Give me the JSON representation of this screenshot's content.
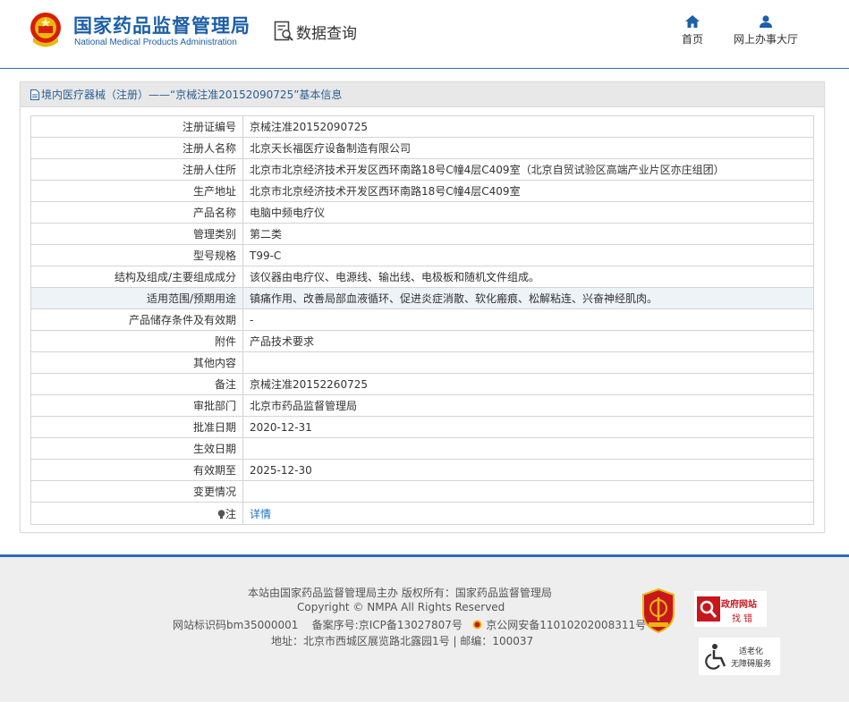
{
  "header": {
    "logo_cn": "国家药品监督管理局",
    "logo_en": "National Medical Products Administration",
    "data_query": "数据查询",
    "nav": [
      {
        "label": "首页",
        "icon": "home-icon"
      },
      {
        "label": "网上办事大厅",
        "icon": "user-icon"
      }
    ]
  },
  "panel": {
    "title": "境内医疗器械（注册）——“京械注准20152090725”基本信息",
    "rows": [
      {
        "key": "注册证编号",
        "value": "京械注准20152090725"
      },
      {
        "key": "注册人名称",
        "value": "北京天长福医疗设备制造有限公司"
      },
      {
        "key": "注册人住所",
        "value": "北京市北京经济技术开发区西环南路18号C幢4层C409室（北京自贸试验区高端产业片区亦庄组团）"
      },
      {
        "key": "生产地址",
        "value": "北京市北京经济技术开发区西环南路18号C幢4层C409室"
      },
      {
        "key": "产品名称",
        "value": "电脑中频电疗仪"
      },
      {
        "key": "管理类别",
        "value": "第二类"
      },
      {
        "key": "型号规格",
        "value": "T99-C"
      },
      {
        "key": "结构及组成/主要组成成分",
        "value": "该仪器由电疗仪、电源线、输出线、电极板和随机文件组成。"
      },
      {
        "key": "适用范围/预期用途",
        "value": "镇痛作用、改善局部血液循环、促进炎症消散、软化瘢痕、松解粘连、兴奋神经肌肉。"
      },
      {
        "key": "产品储存条件及有效期",
        "value": "-"
      },
      {
        "key": "附件",
        "value": "产品技术要求"
      },
      {
        "key": "其他内容",
        "value": ""
      },
      {
        "key": "备注",
        "value": "京械注准20152260725"
      },
      {
        "key": "审批部门",
        "value": "北京市药品监督管理局"
      },
      {
        "key": "批准日期",
        "value": "2020-12-31"
      },
      {
        "key": "生效日期",
        "value": ""
      },
      {
        "key": "有效期至",
        "value": "2025-12-30"
      },
      {
        "key": "变更情况",
        "value": ""
      }
    ],
    "note": {
      "key": "注",
      "value": "详情"
    }
  },
  "footer": {
    "line1": "本站由国家药品监督管理局主办 版权所有：国家药品监督管理局",
    "line2": "Copyright © NMPA All Rights Reserved",
    "site_id": "网站标识码bm35000001",
    "icp": "备案序号:京ICP备13027807号",
    "police": "京公网安备11010202008311号",
    "address": "地址：北京市西城区展览路北露园1号 | 邮编：100037",
    "badge_zc_1": "政府网站",
    "badge_zc_2": "找 错",
    "badge_wza_1": "适老化",
    "badge_wza_2": "无障碍服务"
  },
  "colors": {
    "brand_blue": "#1c5fa8",
    "link": "#1a73c9",
    "highlight_row": "#eef3f8"
  }
}
